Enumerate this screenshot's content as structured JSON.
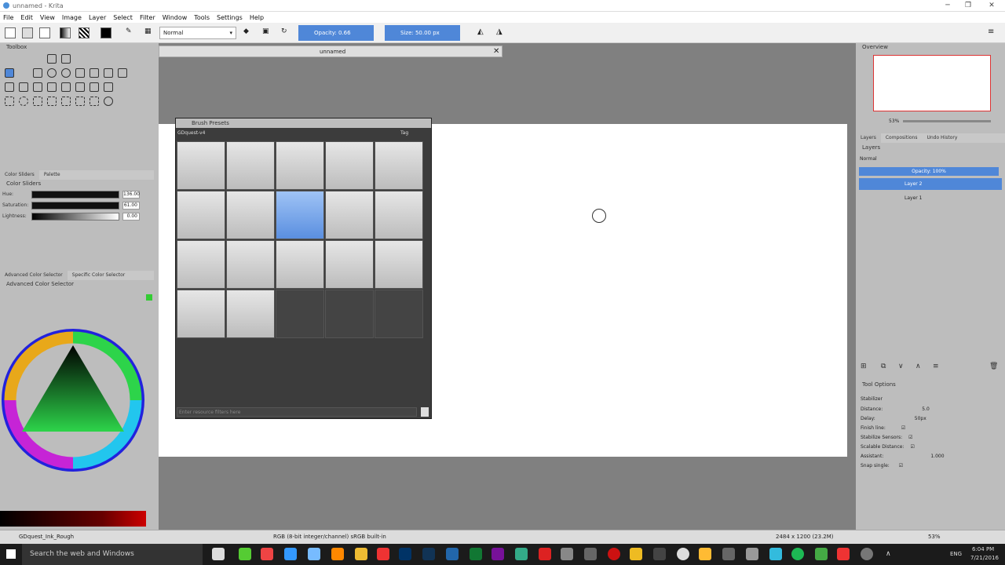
{
  "window": {
    "title": "unnamed - Krita"
  },
  "menu": [
    "File",
    "Edit",
    "View",
    "Image",
    "Layer",
    "Select",
    "Filter",
    "Window",
    "Tools",
    "Settings",
    "Help"
  ],
  "toolbar": {
    "blend_mode": "Normal",
    "opacity_label": "Opacity: 0.66",
    "size_label": "Size: 50.00 px"
  },
  "toolbox": {
    "title": "Toolbox"
  },
  "left_tabs": {
    "color_sliders": "Color Sliders",
    "palette": "Palette",
    "advanced_color_selector": "Advanced Color Selector",
    "specific_color_selector": "Specific Color Selector"
  },
  "color_sliders": {
    "title": "Color Sliders",
    "hue_label": "Hue:",
    "hue_value": "136.00",
    "saturation_label": "Saturation:",
    "saturation_value": "61.00",
    "lightness_label": "Lightness:",
    "lightness_value": "0.00"
  },
  "advanced_color_selector": {
    "title": "Advanced Color Selector"
  },
  "document": {
    "tab_title": "unnamed"
  },
  "brush_presets": {
    "title": "Brush Presets",
    "tag_name": "GDquest-v4",
    "tag_button": "Tag",
    "filter_placeholder": "Enter resource filters here"
  },
  "overview": {
    "title": "Overview",
    "zoom": "53%"
  },
  "layers_tabs": {
    "layers": "Layers",
    "compositions": "Compositions",
    "undo_history": "Undo History"
  },
  "layers": {
    "title": "Layers",
    "blend_mode": "Normal",
    "opacity": "Opacity: 100%",
    "items": [
      "Layer 2",
      "Layer 1"
    ]
  },
  "tool_options": {
    "title": "Tool Options",
    "stabilizer": "Stabilizer",
    "distance_label": "Distance:",
    "distance_value": "5.0",
    "delay_label": "Delay:",
    "delay_value": "50px",
    "finish_line": "Finish line:",
    "stabilize_sensors": "Stabilize Sensors:",
    "scalable_distance": "Scalable Distance:",
    "assistant_label": "Assistant:",
    "assistant_value": "1.000",
    "snap_single": "Snap single:"
  },
  "status": {
    "brush": "GDquest_Ink_Rough",
    "color_model": "RGB (8-bit integer/channel)  sRGB built-in",
    "dimensions": "2484 x 1200 (23.2M)",
    "zoom": "53%"
  },
  "taskbar": {
    "search": "Search the web and Windows",
    "lang": "ENG",
    "time": "6:04 PM",
    "date": "7/21/2016"
  }
}
